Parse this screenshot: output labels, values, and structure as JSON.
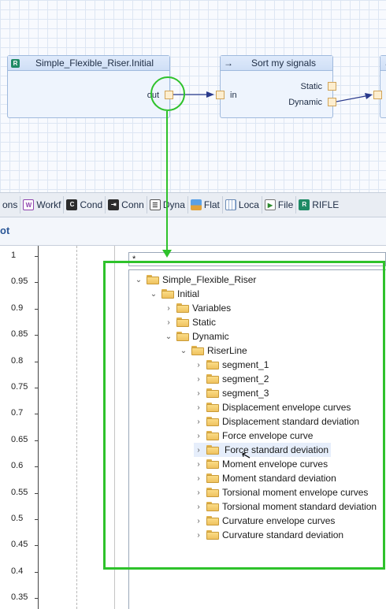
{
  "canvas": {
    "node_initial": {
      "title": "Simple_Flexible_Riser.Initial",
      "icon_glyph": "R",
      "out_label": "out"
    },
    "node_sort": {
      "title": "Sort my signals",
      "icon_glyph": "→",
      "in_label": "in",
      "static_label": "Static",
      "dynamic_label": "Dynamic"
    }
  },
  "tabs": [
    {
      "label": "ons",
      "icon": "none"
    },
    {
      "label": "Workf",
      "icon": "workflow-icon"
    },
    {
      "label": "Cond",
      "icon": "condition-icon"
    },
    {
      "label": "Conn",
      "icon": "connector-icon"
    },
    {
      "label": "Dyna",
      "icon": "dynamic-icon"
    },
    {
      "label": "Flat",
      "icon": "flat-icon"
    },
    {
      "label": "Loca",
      "icon": "local-icon"
    },
    {
      "label": "File",
      "icon": "file-icon"
    },
    {
      "label": "RIFLE",
      "icon": "riflex-icon"
    }
  ],
  "panel": {
    "title": "ot"
  },
  "plot": {
    "y_ticks": [
      "1",
      "0.95",
      "0.9",
      "0.85",
      "0.8",
      "0.75",
      "0.7",
      "0.65",
      "0.6",
      "0.55",
      "0.5",
      "0.45",
      "0.4",
      "0.35"
    ]
  },
  "filter": {
    "value": "*"
  },
  "tree": [
    {
      "label": "Simple_Flexible_Riser",
      "depth": 0,
      "state": "expanded"
    },
    {
      "label": "Initial",
      "depth": 1,
      "state": "expanded"
    },
    {
      "label": "Variables",
      "depth": 2,
      "state": "collapsed"
    },
    {
      "label": "Static",
      "depth": 2,
      "state": "collapsed"
    },
    {
      "label": "Dynamic",
      "depth": 2,
      "state": "expanded"
    },
    {
      "label": "RiserLine",
      "depth": 3,
      "state": "expanded"
    },
    {
      "label": "segment_1",
      "depth": 4,
      "state": "collapsed"
    },
    {
      "label": "segment_2",
      "depth": 4,
      "state": "collapsed"
    },
    {
      "label": "segment_3",
      "depth": 4,
      "state": "collapsed"
    },
    {
      "label": "Displacement envelope curves",
      "depth": 4,
      "state": "collapsed"
    },
    {
      "label": "Displacement standard deviation",
      "depth": 4,
      "state": "collapsed"
    },
    {
      "label": "Force envelope curve",
      "depth": 4,
      "state": "collapsed"
    },
    {
      "label": "Force standard deviation",
      "depth": 4,
      "state": "collapsed",
      "selected": true
    },
    {
      "label": "Moment envelope curves",
      "depth": 4,
      "state": "collapsed"
    },
    {
      "label": "Moment standard deviation",
      "depth": 4,
      "state": "collapsed"
    },
    {
      "label": "Torsional moment envelope curves",
      "depth": 4,
      "state": "collapsed"
    },
    {
      "label": "Torsional moment standard deviation",
      "depth": 4,
      "state": "collapsed"
    },
    {
      "label": "Curvature envelope curves",
      "depth": 4,
      "state": "collapsed"
    },
    {
      "label": "Curvature standard deviation",
      "depth": 4,
      "state": "collapsed"
    }
  ],
  "colors": {
    "accent_green": "#2ec22b",
    "node_fill": "#eef4fd",
    "port_fill": "#fdeecf",
    "folder": "#f5cd6c"
  }
}
